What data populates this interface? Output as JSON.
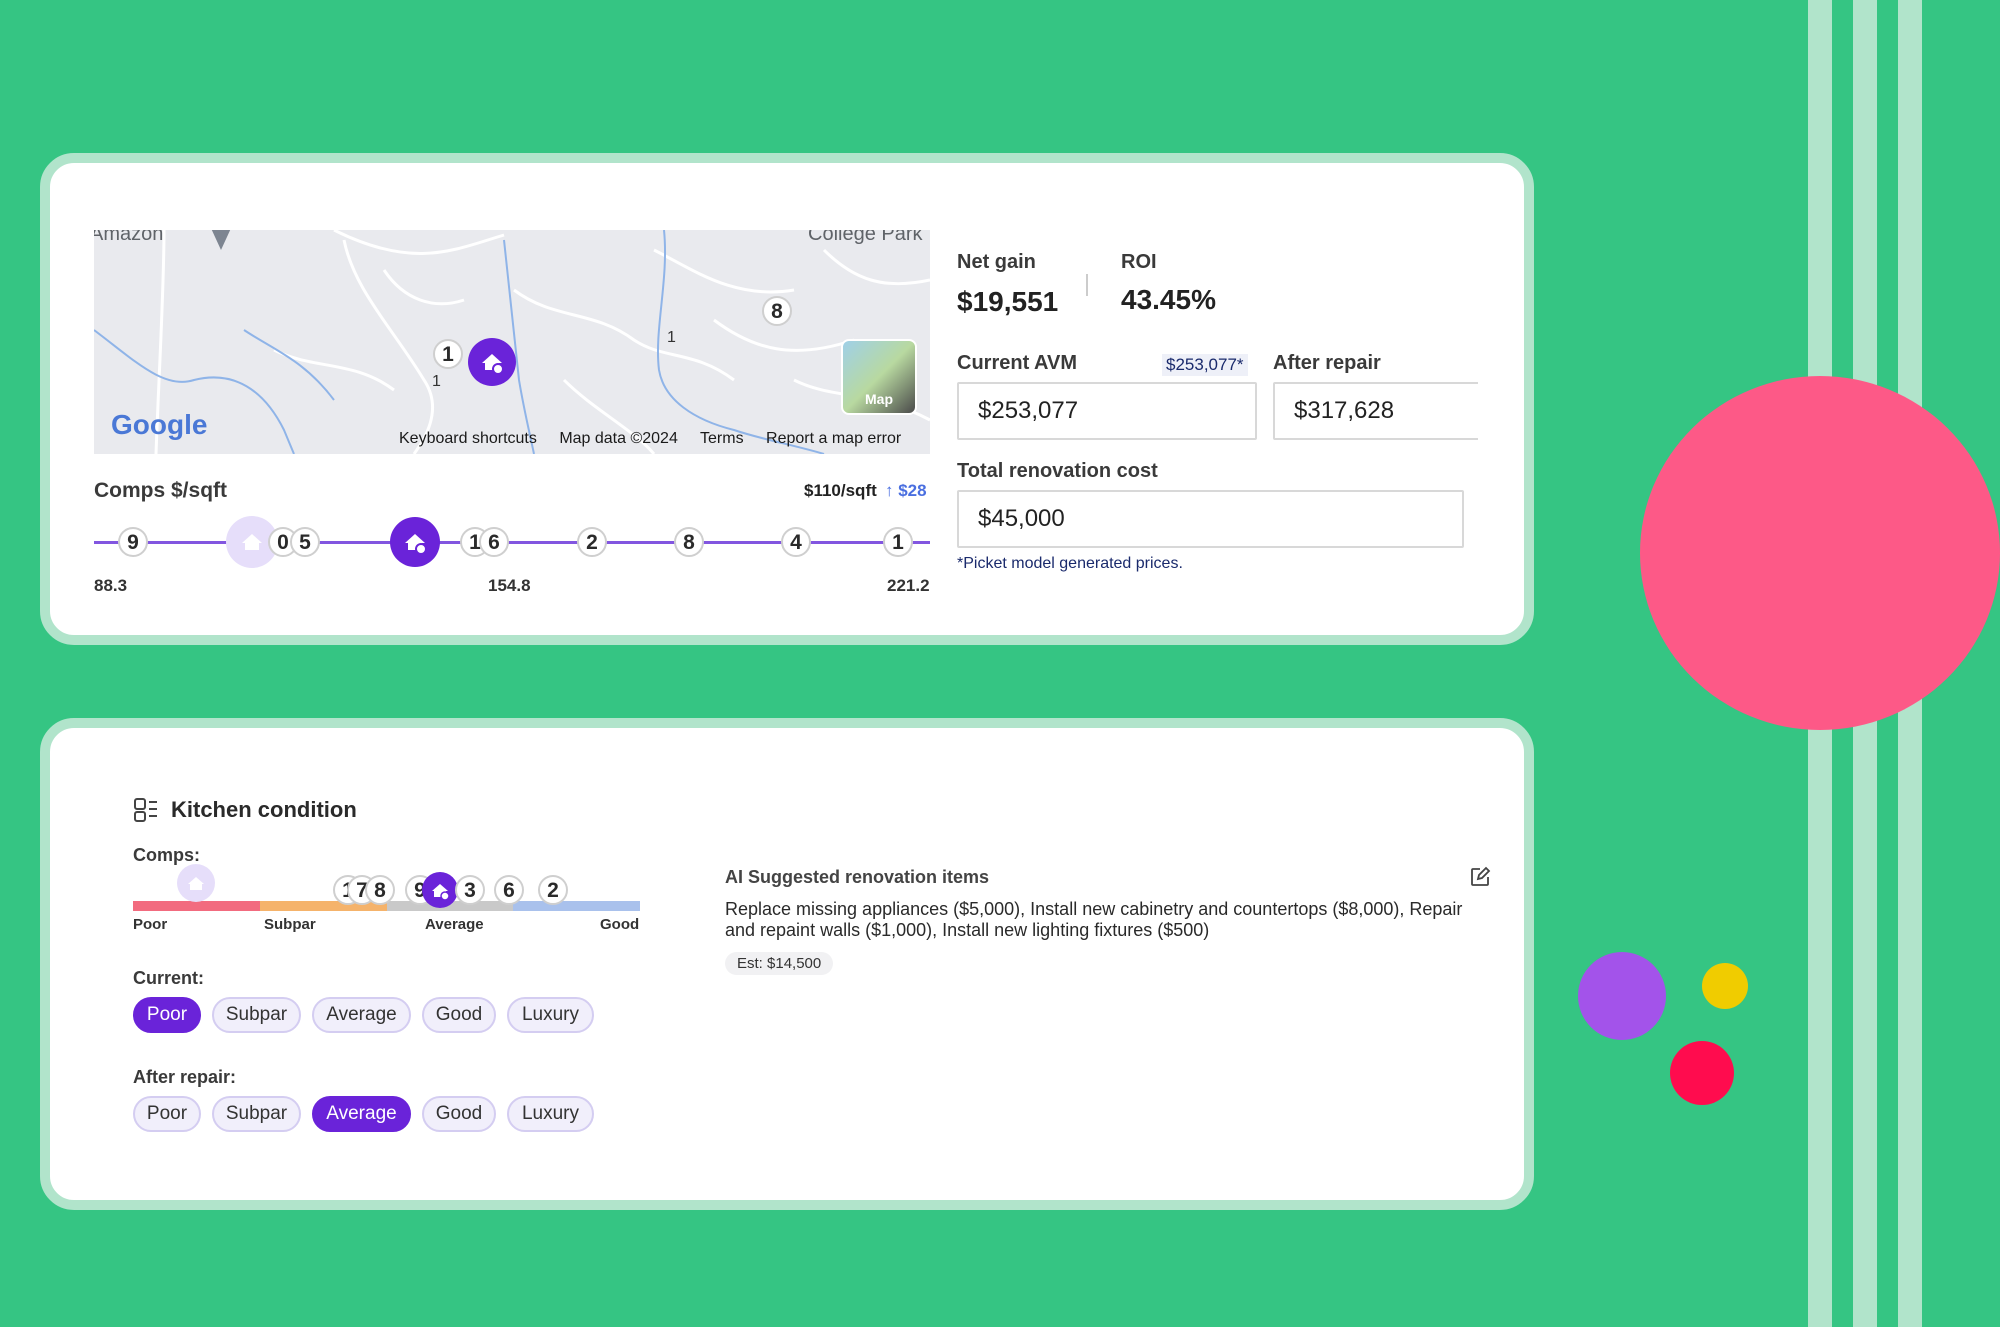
{
  "map": {
    "place_labels": [
      "Amazon",
      "College Park"
    ],
    "markers": [
      "1",
      "1",
      "8",
      "1"
    ],
    "google_logo": "Google",
    "map_type_label": "Map",
    "footer": [
      "Keyboard shortcuts",
      "Map data ©2024",
      "Terms",
      "Report a map error"
    ]
  },
  "comps": {
    "title": "Comps $/sqft",
    "price_per_sqft": "$110/sqft",
    "delta": "↑ $28",
    "nodes": [
      "9",
      "0",
      "5",
      "1",
      "6",
      "2",
      "8",
      "4",
      "1"
    ],
    "scale": [
      "88.3",
      "154.8",
      "221.2"
    ],
    "pin_icon": "house-check-icon"
  },
  "summary": {
    "net_gain_label": "Net gain",
    "net_gain_value": "$19,551",
    "roi_label": "ROI",
    "roi_value": "43.45%",
    "current_avm_label": "Current AVM",
    "current_avm_badge": "$253,077*",
    "current_avm_value": "$253,077",
    "after_repair_label": "After repair",
    "after_repair_value": "$317,628",
    "total_renovation_label": "Total renovation cost",
    "total_renovation_value": "$45,000",
    "footnote": "*Picket model generated prices."
  },
  "kitchen": {
    "title": "Kitchen condition",
    "title_icon": "kitchen-appliance-icon",
    "comps_label": "Comps:",
    "comp_nodes": [
      "1",
      "7",
      "8",
      "9",
      "3",
      "6",
      "2"
    ],
    "scale_labels": [
      "Poor",
      "Subpar",
      "Average",
      "Good"
    ],
    "scale_colors": [
      "#f26b7f",
      "#f5b36b",
      "#c9c9c9",
      "#a9c1ec"
    ],
    "current_label": "Current:",
    "after_repair_label": "After repair:",
    "options": [
      "Poor",
      "Subpar",
      "Average",
      "Good",
      "Luxury"
    ],
    "current_selected": "Poor",
    "after_repair_selected": "Average",
    "ai_title": "AI Suggested renovation items",
    "ai_text": "Replace missing appliances ($5,000), Install new cabinetry and countertops ($8,000), Repair and repaint walls ($1,000), Install new lighting fixtures ($500)",
    "estimate": "Est: $14,500",
    "edit_icon": "edit-icon"
  },
  "colors": {
    "background": "#35c583",
    "accent": "#6a23d9",
    "pink": "#fd5987",
    "purple": "#a353ea",
    "yellow": "#f0cc00",
    "red": "#ff0c4e"
  }
}
